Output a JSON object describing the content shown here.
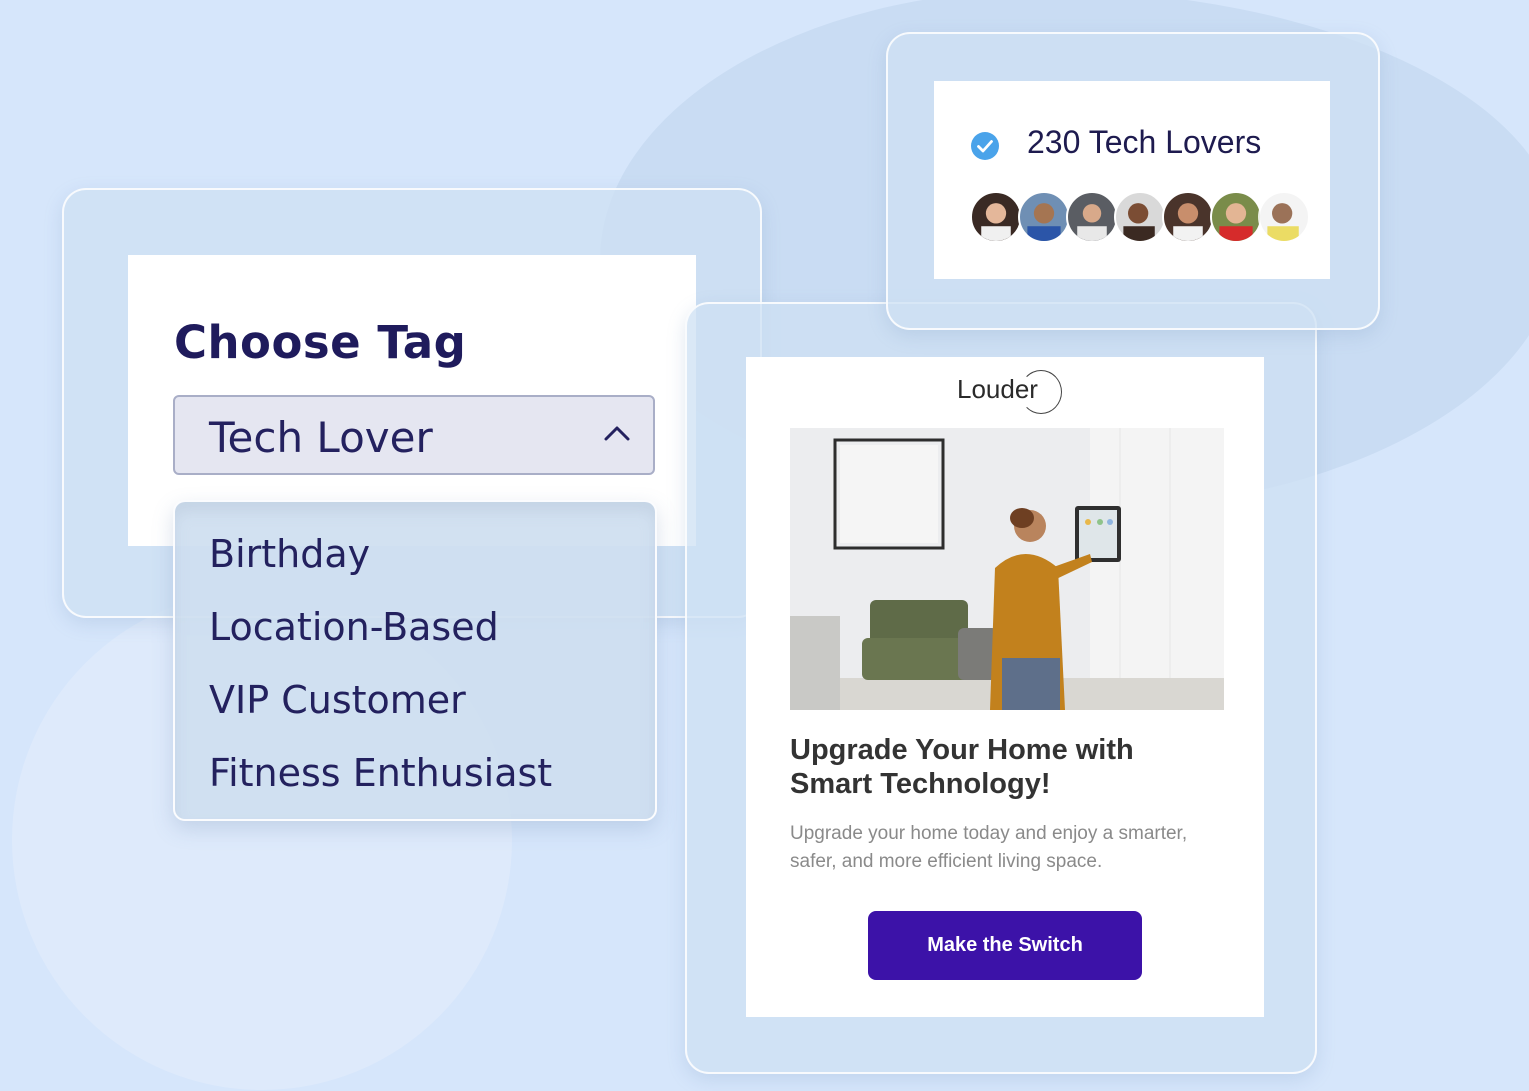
{
  "tag_picker": {
    "title": "Choose Tag",
    "selected": "Tech Lover",
    "options": [
      "Birthday",
      "Location-Based",
      "VIP Customer",
      "Fitness Enthusiast"
    ]
  },
  "audience": {
    "title": "230 Tech Lovers",
    "avatar_count_shown": 7
  },
  "email": {
    "logo_text": "Louder",
    "headline": "Upgrade Your Home with Smart Technology!",
    "body": "Upgrade your home today and enjoy a smarter, safer, and more efficient living space.",
    "cta_label": "Make the Switch"
  },
  "colors": {
    "background": "#d6e6fb",
    "title_navy": "#1f1b5c",
    "cta_purple": "#3c12a8",
    "check_blue": "#4aa3ea"
  },
  "icons": [
    "chevron-up-icon",
    "check-circle-icon"
  ]
}
